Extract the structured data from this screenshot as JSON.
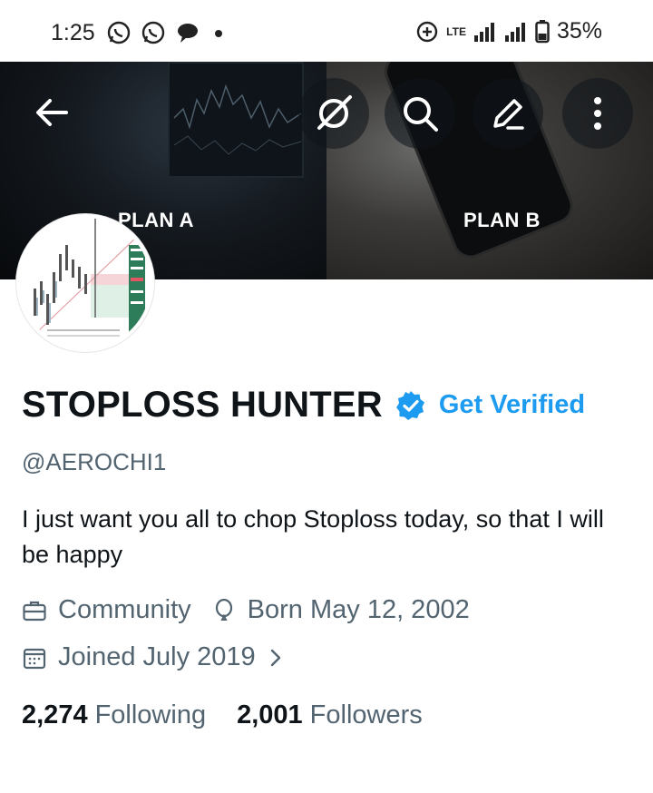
{
  "status_bar": {
    "time": "1:25",
    "network": "LTE",
    "battery": "35%",
    "icons_left": [
      "whatsapp-icon",
      "whatsapp-icon",
      "chat-bubble-icon",
      "dot-icon"
    ],
    "icons_right": [
      "data-saver-icon",
      "signal-icon",
      "signal-icon",
      "battery-icon"
    ]
  },
  "banner": {
    "label_a": "PLAN A",
    "label_b": "PLAN B",
    "icons": [
      "back-arrow-icon",
      "grok-icon",
      "search-icon",
      "edit-icon",
      "more-vertical-icon"
    ]
  },
  "profile": {
    "display_name": "STOPLOSS HUNTER",
    "get_verified": "Get Verified",
    "handle": "@AEROCHI1",
    "bio": "I just want you all to chop Stoploss today, so that I will be happy",
    "category": "Community",
    "birthday": "Born May 12, 2002",
    "joined": "Joined July 2019",
    "following_count": "2,274",
    "following_label": "Following",
    "followers_count": "2,001",
    "followers_label": "Followers"
  },
  "colors": {
    "accent": "#1d9bf0",
    "text_primary": "#0f1419",
    "text_secondary": "#536471"
  }
}
